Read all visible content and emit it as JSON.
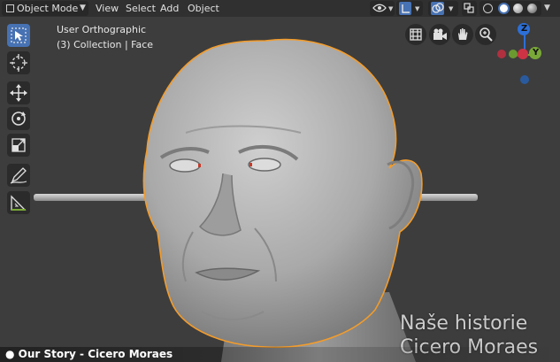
{
  "header": {
    "mode_select": "Object Mode",
    "menus": [
      "View",
      "Select",
      "Add",
      "Object"
    ]
  },
  "viewport": {
    "view_label": "User Orthographic",
    "collection_label": "(3) Collection | Face"
  },
  "gizmo": {
    "z_label": "Z",
    "y_label": "Y",
    "x_color": "#cc3344",
    "y_color": "#7aa838",
    "z_color": "#2c6fd6"
  },
  "tools": [
    "select-box",
    "cursor",
    "move",
    "rotate",
    "scale",
    "annotate",
    "measure"
  ],
  "nav_buttons": [
    "grid",
    "camera",
    "hand",
    "zoom"
  ],
  "colors": {
    "selection_outline": "#f39c2b",
    "active_tool": "#4772b3",
    "eye_red": "#c43a2a"
  },
  "watermark": {
    "line1": "Naše historie",
    "line2": "Cicero Moraes"
  },
  "caption": "● Our Story - Cicero Moraes"
}
